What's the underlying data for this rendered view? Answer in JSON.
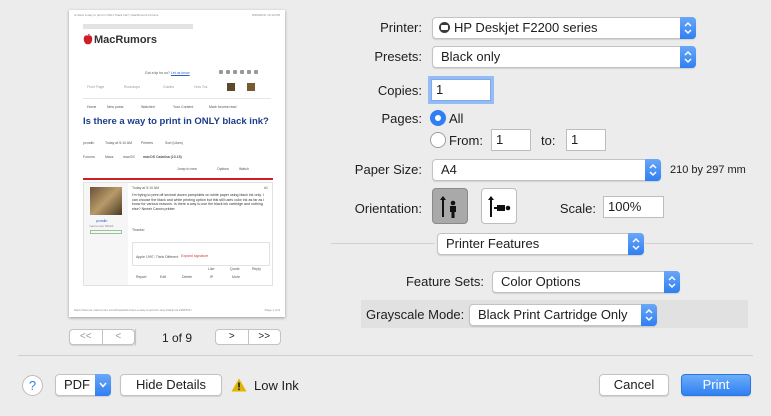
{
  "preview": {
    "page_header_left": "Is there a way to print in ONLY black ink? | MacRumors Forums",
    "page_header_right": "8/29/2019, 10:14 PM",
    "site_logo": "MacRumors",
    "tip_line": "Got a tip for us?",
    "tip_link": "Let us know",
    "nav_tabs": [
      "Front Page",
      "Roundups",
      "Guides",
      "How Tos"
    ],
    "forum_nav": [
      "Home",
      "New posts",
      "Watched",
      "Your Content",
      "Mark forums read"
    ],
    "thread_title": "Is there a way to print in ONLY black ink?",
    "thread_meta": [
      "pcmdln",
      "Today at 5:10 AM",
      "Printers",
      "Sort (Likes)"
    ],
    "breadcrumb": [
      "Forums",
      "Macs",
      "macOS",
      "macOS Catalina (10.15)"
    ],
    "thread_tools": [
      "Jump to new",
      "Options",
      "Watch"
    ],
    "post_date": "Today at 5:10 AM",
    "post_number": "#1",
    "post_user": "pcmdln",
    "post_role": "macrumors 6502A",
    "post_body": "I'm trying to print off several dozen pamphlets on white paper using black ink only. I can choose the black and white printing option but this still uses color ink as far as I know for various reasons. Is there a way to use the black ink cartridge and nothing else? Newer Canon printer.",
    "post_thanks": "Thanks!",
    "signature": "Apple 1997; Think Different",
    "signature_link": "Expand signature",
    "post_actions": [
      "Like",
      "Quote",
      "Reply"
    ],
    "mod_actions": [
      "Report",
      "Edit",
      "Delete",
      "IP",
      "More"
    ],
    "footer_url": "https://forums.macrumors.com/threads/is-there-a-way-to-print-in-only-black-ink.2206571/",
    "footer_page": "Page 1 of 9"
  },
  "pager": {
    "first": "<<",
    "prev": "<",
    "next": ">",
    "last": ">>",
    "status": "1 of 9"
  },
  "printer": {
    "label": "Printer:",
    "value": "HP Deskjet F2200 series"
  },
  "presets": {
    "label": "Presets:",
    "value": "Black only"
  },
  "copies": {
    "label": "Copies:",
    "value": "1"
  },
  "pages": {
    "label": "Pages:",
    "all_label": "All",
    "all_selected": true,
    "from_label": "From:",
    "from_value": "1",
    "to_label": "to:",
    "to_value": "1"
  },
  "paper_size": {
    "label": "Paper Size:",
    "value": "A4",
    "dimensions": "210 by 297 mm"
  },
  "orientation": {
    "label": "Orientation:",
    "selected": "portrait",
    "options": [
      "portrait-icon",
      "landscape-icon"
    ]
  },
  "scale": {
    "label": "Scale:",
    "value": "100%"
  },
  "section_popup": {
    "value": "Printer Features"
  },
  "feature_sets": {
    "label": "Feature Sets:",
    "value": "Color Options"
  },
  "grayscale": {
    "label": "Grayscale Mode:",
    "value": "Black Print Cartridge Only"
  },
  "footer": {
    "help": "?",
    "pdf": "PDF",
    "hide_details": "Hide Details",
    "warning_text": "Low Ink",
    "cancel": "Cancel",
    "print": "Print"
  },
  "colors": {
    "accent": "#2f7ff2",
    "window_bg": "#ececec",
    "brand_red": "#cc1f27",
    "warning": "#e0b400"
  }
}
